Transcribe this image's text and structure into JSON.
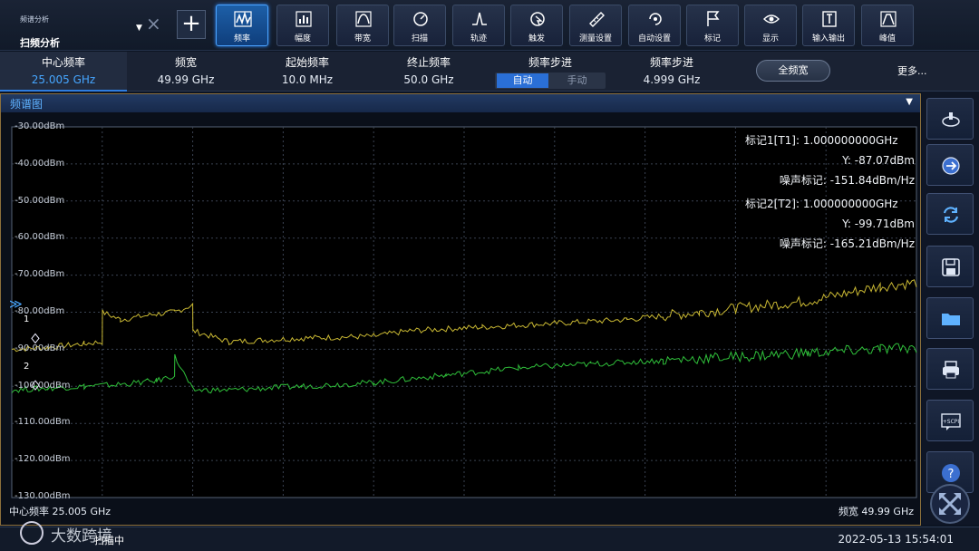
{
  "toolbar": {
    "mode_small": "频谱分析",
    "mode_main": "扫频分析",
    "buttons": [
      {
        "label": "频率",
        "icon": "frequency-icon"
      },
      {
        "label": "幅度",
        "icon": "amplitude-icon"
      },
      {
        "label": "带宽",
        "icon": "bandwidth-icon"
      },
      {
        "label": "扫描",
        "icon": "sweep-icon"
      },
      {
        "label": "轨迹",
        "icon": "trace-icon"
      },
      {
        "label": "触发",
        "icon": "trigger-icon"
      },
      {
        "label": "测量设置",
        "icon": "measure-icon"
      },
      {
        "label": "自动设置",
        "icon": "auto-icon"
      },
      {
        "label": "标记",
        "icon": "flag-icon"
      },
      {
        "label": "显示",
        "icon": "eye-icon"
      },
      {
        "label": "输入输出",
        "icon": "io-icon"
      },
      {
        "label": "峰值",
        "icon": "peak-icon"
      }
    ]
  },
  "params": {
    "center": {
      "label": "中心频率",
      "value": "25.005 GHz"
    },
    "span": {
      "label": "频宽",
      "value": "49.99 GHz"
    },
    "start": {
      "label": "起始频率",
      "value": "10.0 MHz"
    },
    "stop": {
      "label": "终止频率",
      "value": "50.0 GHz"
    },
    "step_mode": {
      "label": "频率步进",
      "auto": "自动",
      "manual": "手动"
    },
    "step": {
      "label": "频率步进",
      "value": "4.999 GHz"
    },
    "fullspan": "全频宽",
    "more": "更多..."
  },
  "panel": {
    "title": "频谱图",
    "y_labels": [
      "-30.00dBm",
      "-40.00dBm",
      "-50.00dBm",
      "-60.00dBm",
      "-70.00dBm",
      "-80.00dBm",
      "-90.00dBm",
      "-100.00dBm",
      "-110.00dBm",
      "-120.00dBm",
      "-130.00dBm"
    ],
    "marker1": {
      "line1": "标记1[T1]:    1.000000000GHz",
      "line2": "Y: -87.07dBm",
      "line3": "噪声标记: -151.84dBm/Hz"
    },
    "marker2": {
      "line1": "标记2[T2]:    1.000000000GHz",
      "line2": "Y: -99.71dBm",
      "line3": "噪声标记: -165.21dBm/Hz"
    },
    "bottom_left": "中心频率 25.005 GHz",
    "bottom_right": "频宽 49.99 GHz",
    "marker_tags": [
      "1",
      "2"
    ]
  },
  "chart_data": {
    "type": "line",
    "ylim": [
      -130,
      -30
    ],
    "xlim_ghz": [
      0.01,
      50.0
    ],
    "series": [
      {
        "color": "#c9b833",
        "x": [
          0,
          2,
          4,
          5,
          5.01,
          6,
          8,
          9,
          10,
          10.01,
          12,
          16,
          20,
          22,
          26,
          30,
          34,
          36,
          38,
          40,
          44,
          48,
          50
        ],
        "y": [
          -90,
          -89.5,
          -88.5,
          -88,
          -80,
          -82,
          -80.5,
          -80,
          -78,
          -85,
          -88,
          -87,
          -86.5,
          -85,
          -84,
          -83,
          -82,
          -81,
          -80,
          -79,
          -77,
          -73,
          -72
        ]
      },
      {
        "color": "#2fbf3a",
        "x": [
          0,
          2,
          4,
          6,
          8,
          9,
          9.01,
          10,
          12,
          16,
          20,
          24,
          28,
          32,
          36,
          40,
          44,
          48,
          50
        ],
        "y": [
          -101,
          -100.5,
          -100,
          -99.5,
          -98.5,
          -97,
          -92,
          -101,
          -101,
          -100,
          -99,
          -97,
          -95,
          -94,
          -93,
          -92,
          -91,
          -90,
          -89.5
        ]
      }
    ]
  },
  "sidebar": [
    "cursor-icon",
    "arrow-right-icon",
    "refresh-icon",
    "save-icon",
    "folder-icon",
    "print-icon",
    "scpi-icon",
    "help-icon"
  ],
  "status": {
    "left": "扫描中",
    "time": "2022-05-13 15:54:01"
  },
  "watermark": "大数跨境"
}
